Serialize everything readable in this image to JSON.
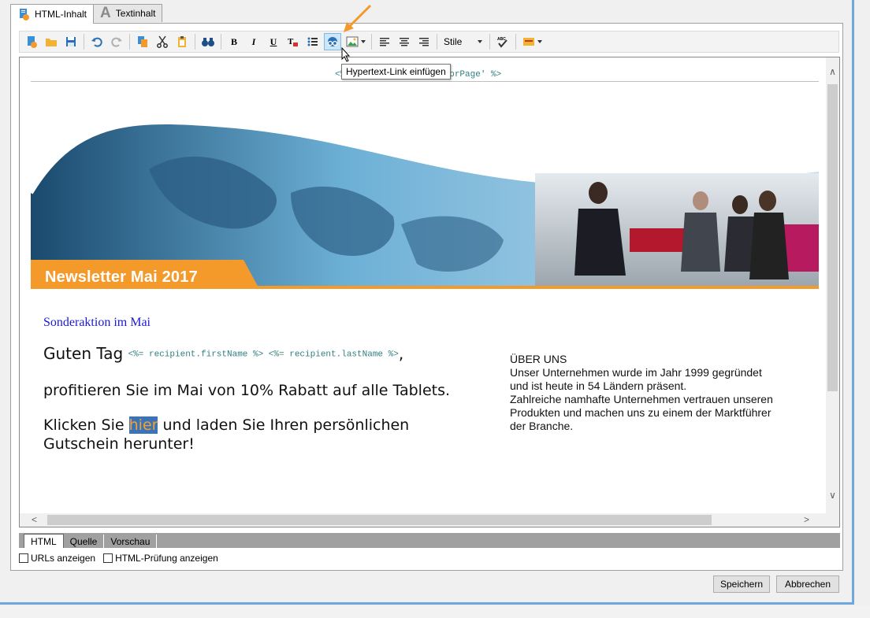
{
  "tabs": [
    {
      "label": "HTML-Inhalt",
      "icon": "html-content-icon",
      "active": true
    },
    {
      "label": "Textinhalt",
      "icon": "text-content-icon",
      "active": false
    }
  ],
  "toolbar": {
    "styles_label": "Stile",
    "tooltip": "Hypertext-Link einfügen"
  },
  "editor": {
    "page_tag": "<%@ include view='MirrorPage' %>",
    "banner_title": "Newsletter Mai 2017",
    "promo_heading": "Sonderaktion im Mai",
    "greeting_text": "Guten Tag",
    "greeting_code": "<%= recipient.firstName %> <%= recipient.lastName %>",
    "greeting_suffix": ",",
    "paragraph1": "profitieren Sie im Mai von 10% Rabatt auf alle Tablets.",
    "paragraph2_before": "Klicken Sie ",
    "paragraph2_link": "hier",
    "paragraph2_after": " und laden Sie Ihren persönlichen Gutschein herunter!",
    "about_title": "ÜBER UNS",
    "about_line1": "Unser Unternehmen wurde im Jahr 1999 gegründet",
    "about_line2": "und ist heute in 54 Ländern präsent.",
    "about_line3": "Zahlreiche namhafte Unternehmen vertrauen unseren",
    "about_line4": "Produkten und machen uns zu einem der Marktführer",
    "about_line5": "der Branche."
  },
  "view_tabs": [
    {
      "label": "HTML",
      "active": true
    },
    {
      "label": "Quelle",
      "active": false
    },
    {
      "label": "Vorschau",
      "active": false
    }
  ],
  "options": {
    "show_urls": "URLs anzeigen",
    "show_html_check": "HTML-Prüfung anzeigen"
  },
  "buttons": {
    "save": "Speichern",
    "cancel": "Abbrechen"
  },
  "colors": {
    "accent_orange": "#f39a2b",
    "window_border": "#6ea8de",
    "link_highlight": "#3a73b8"
  }
}
